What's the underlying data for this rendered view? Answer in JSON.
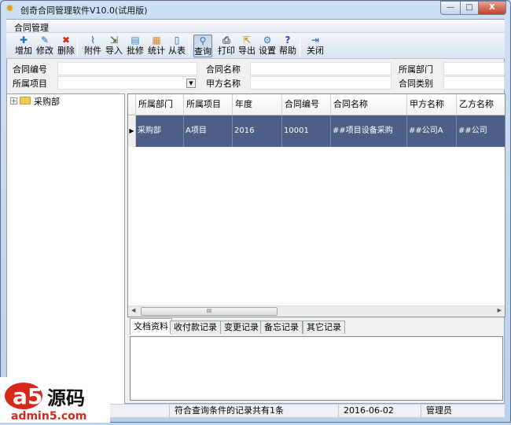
{
  "window": {
    "title": "创奇合同管理软件V10.0(试用版)",
    "minimize": "—",
    "maximize": "□",
    "close": "X"
  },
  "menu": {
    "items": [
      "合同管理"
    ]
  },
  "toolbar": {
    "buttons": [
      {
        "label": "增加",
        "icon": "add-icon",
        "glyph": "✚",
        "color": "#1e6fd1"
      },
      {
        "label": "修改",
        "icon": "pencil-icon",
        "glyph": "✎",
        "color": "#2f5fbf"
      },
      {
        "label": "删除",
        "icon": "delete-icon",
        "glyph": "✖",
        "color": "#d02a1a"
      },
      {
        "label": "附件",
        "icon": "paperclip-icon",
        "glyph": "⌇",
        "color": "#5577aa"
      },
      {
        "label": "导入",
        "icon": "import-icon",
        "glyph": "⇲",
        "color": "#3a6a3a"
      },
      {
        "label": "批修",
        "icon": "batch-edit-icon",
        "glyph": "▤",
        "color": "#3a86c8"
      },
      {
        "label": "统计",
        "icon": "statistics-icon",
        "glyph": "▦",
        "color": "#d9822b"
      },
      {
        "label": "从表",
        "icon": "sub-table-icon",
        "glyph": "▯",
        "color": "#2d5ea8"
      },
      {
        "label": "查询",
        "icon": "search-icon",
        "glyph": "⚲",
        "color": "#2d6fb5"
      },
      {
        "label": "打印",
        "icon": "printer-icon",
        "glyph": "⎙",
        "color": "#555"
      },
      {
        "label": "导出",
        "icon": "export-icon",
        "glyph": "⇱",
        "color": "#c89a20"
      },
      {
        "label": "设置",
        "icon": "gear-icon",
        "glyph": "⚙",
        "color": "#2f7fd0"
      },
      {
        "label": "帮助",
        "icon": "help-icon",
        "glyph": "?",
        "color": "#2050b0"
      },
      {
        "label": "关闭",
        "icon": "exit-icon",
        "glyph": "⇥",
        "color": "#3a7acc"
      }
    ]
  },
  "filters": {
    "contract_no": {
      "label": "合同编号",
      "value": ""
    },
    "contract_name": {
      "label": "合同名称",
      "value": ""
    },
    "department": {
      "label": "所属部门",
      "value": ""
    },
    "project": {
      "label": "所属项目",
      "value": ""
    },
    "party_a": {
      "label": "甲方名称",
      "value": ""
    },
    "category": {
      "label": "合同类别",
      "value": ""
    }
  },
  "tree": {
    "root": "采购部"
  },
  "grid": {
    "columns": [
      "所属部门",
      "所属项目",
      "年度",
      "合同编号",
      "合同名称",
      "甲方名称",
      "乙方名称"
    ],
    "rows": [
      [
        "采购部",
        "A项目",
        "2016",
        "10001",
        "##项目设备采购",
        "##公司A",
        "##公司"
      ]
    ],
    "scroll_thumb": "III"
  },
  "tabs": [
    "文档资料",
    "收付款记录",
    "变更记录",
    "备忘记录",
    "其它记录"
  ],
  "status": {
    "message": "符合查询条件的记录共有1条",
    "date": "2016-06-02",
    "user": "管理员"
  },
  "watermark": {
    "text": "a5源码",
    "url": "admin5.com"
  }
}
